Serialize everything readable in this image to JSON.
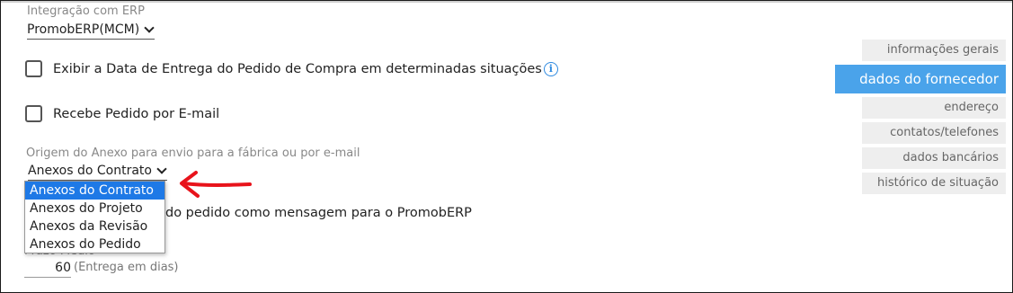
{
  "erp": {
    "label": "Integração com ERP",
    "value": "PromobERP(MCM)"
  },
  "options": {
    "data_entrega_label": "Exibir a Data de Entrega do Pedido de Compra em determinadas situações",
    "email_label": "Recebe Pedido por E-mail",
    "mensagem_partial_label": "do pedido como mensagem para o PromobERP"
  },
  "anexo": {
    "label": "Origem do Anexo para envio para a fábrica ou por e-mail",
    "value": "Anexos do Contrato",
    "dropdown_options": [
      "Anexos do Contrato",
      "Anexos do Projeto",
      "Anexos da Revisão",
      "Anexos do Pedido"
    ],
    "selected_index": 0
  },
  "prazo": {
    "label": "Prazo Médio",
    "value": "60",
    "unit": "(Entrega em dias)"
  },
  "sidebar": {
    "items": [
      {
        "label": "informações gerais",
        "active": false
      },
      {
        "label": "dados do fornecedor",
        "active": true
      },
      {
        "label": "endereço",
        "active": false
      },
      {
        "label": "contatos/telefones",
        "active": false
      },
      {
        "label": "dados bancários",
        "active": false
      },
      {
        "label": "histórico de situação",
        "active": false
      }
    ]
  },
  "colors": {
    "accent": "#4aa3ea",
    "selection": "#1e79e6",
    "annotation_arrow": "#e8131b"
  }
}
